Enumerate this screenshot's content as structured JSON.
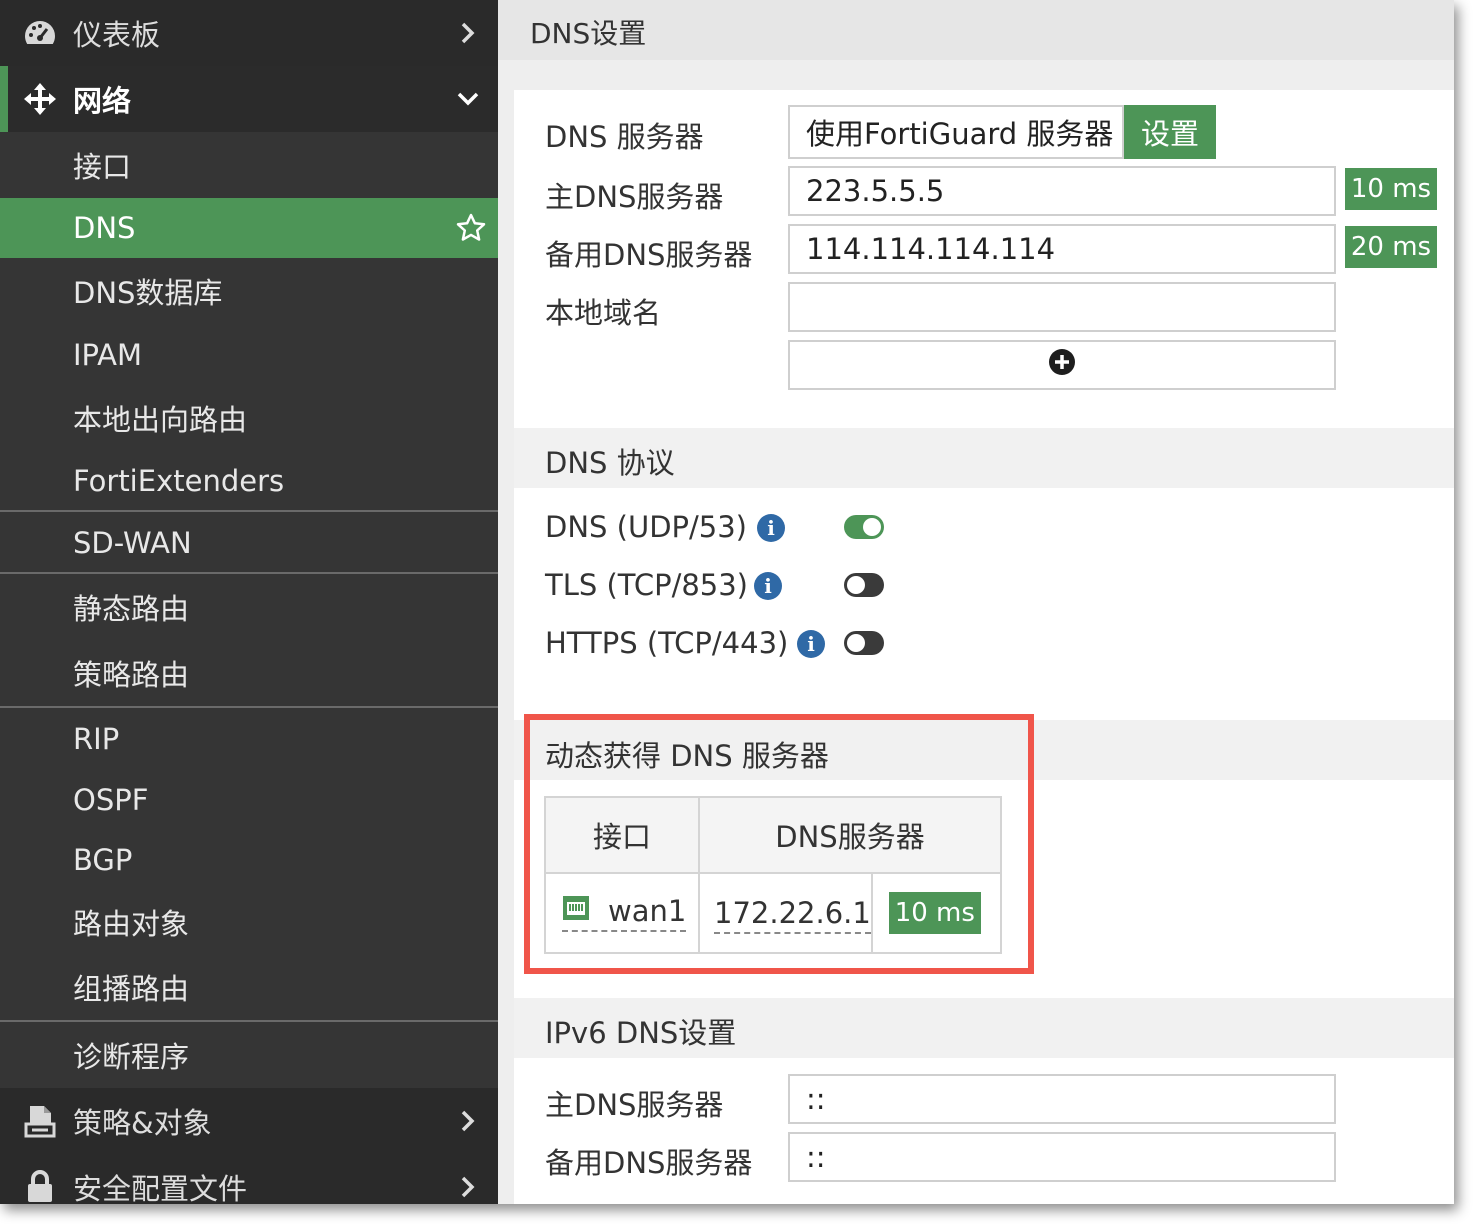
{
  "sidebar": {
    "items": [
      {
        "label": "仪表板",
        "icon": "dashboard-icon"
      },
      {
        "label": "网络",
        "icon": "move-icon"
      },
      {
        "label": "接口"
      },
      {
        "label": "DNS"
      },
      {
        "label": "DNS数据库"
      },
      {
        "label": "IPAM"
      },
      {
        "label": "本地出向路由"
      },
      {
        "label": "FortiExtenders"
      },
      {
        "label": "SD-WAN"
      },
      {
        "label": "静态路由"
      },
      {
        "label": "策略路由"
      },
      {
        "label": "RIP"
      },
      {
        "label": "OSPF"
      },
      {
        "label": "BGP"
      },
      {
        "label": "路由对象"
      },
      {
        "label": "组播路由"
      },
      {
        "label": "诊断程序"
      },
      {
        "label": "策略&对象",
        "icon": "policy-document-icon"
      },
      {
        "label": "安全配置文件",
        "icon": "lock-icon"
      }
    ]
  },
  "page": {
    "title": "DNS设置"
  },
  "dns": {
    "server_label": "DNS 服务器",
    "server_value": "使用FortiGuard 服务器",
    "set_button": "设置",
    "primary_label": "主DNS服务器",
    "primary_value": "223.5.5.5",
    "primary_latency": "10 ms",
    "secondary_label": "备用DNS服务器",
    "secondary_value": "114.114.114.114",
    "secondary_latency": "20 ms",
    "local_domain_label": "本地域名",
    "local_domain_value": ""
  },
  "protocol": {
    "title": "DNS 协议",
    "items": [
      {
        "label": "DNS (UDP/53)",
        "enabled": true
      },
      {
        "label": "TLS (TCP/853)",
        "enabled": false
      },
      {
        "label": "HTTPS (TCP/443)",
        "enabled": false
      }
    ]
  },
  "dynamic": {
    "title": "动态获得 DNS 服务器",
    "col_interface": "接口",
    "col_dns": "DNS服务器",
    "row": {
      "interface": "wan1",
      "dns": "172.22.6.1",
      "latency": "10 ms"
    }
  },
  "ipv6": {
    "title": "IPv6 DNS设置",
    "primary_label": "主DNS服务器",
    "primary_value": "::",
    "secondary_label": "备用DNS服务器",
    "secondary_value": "::"
  },
  "colors": {
    "accent": "#4d9557",
    "sidebar": "#353535",
    "highlight": "#f0554a",
    "info": "#2f69a6"
  }
}
